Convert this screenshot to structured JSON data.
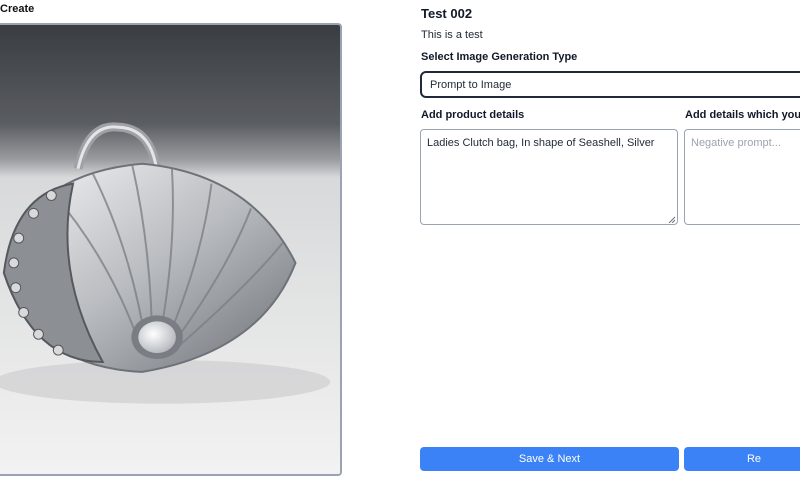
{
  "page": {
    "section_label": "Create"
  },
  "project": {
    "title": "Test 002",
    "description": "This is a test"
  },
  "generation_type": {
    "label": "Select Image Generation Type",
    "value": "Prompt to Image"
  },
  "product_details": {
    "label": "Add product details",
    "value": "Ladies Clutch bag, In shape of Seashell, Silver"
  },
  "negative_details": {
    "label": "Add details which you do",
    "placeholder": "Negative prompt..."
  },
  "actions": {
    "save_next_label": "Save & Next",
    "second_label": "Re"
  },
  "colors": {
    "accent": "#3b82f6",
    "border": "#9aa3b2"
  }
}
